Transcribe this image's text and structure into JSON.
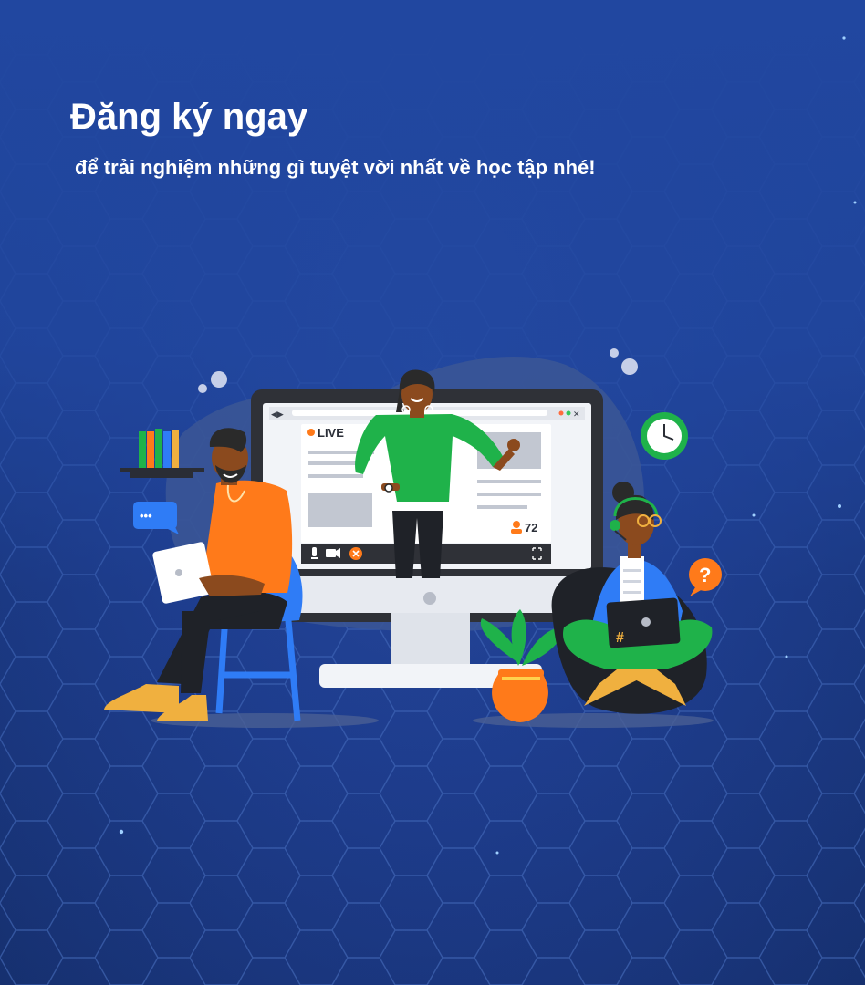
{
  "hero": {
    "title": "Đăng ký ngay",
    "subtitle": "để trải nghiệm những gì tuyệt vời nhất về học tập nhé!"
  },
  "illustration": {
    "live_label": "LIVE",
    "viewer_count": "72",
    "hashtag": "#",
    "question_mark": "?",
    "chat_dots": "•••"
  },
  "colors": {
    "background": "#1e3c8c",
    "text": "#ffffff",
    "accent_orange": "#ff7a1a",
    "accent_green": "#1fb24a",
    "accent_blue": "#2f7cf6"
  }
}
